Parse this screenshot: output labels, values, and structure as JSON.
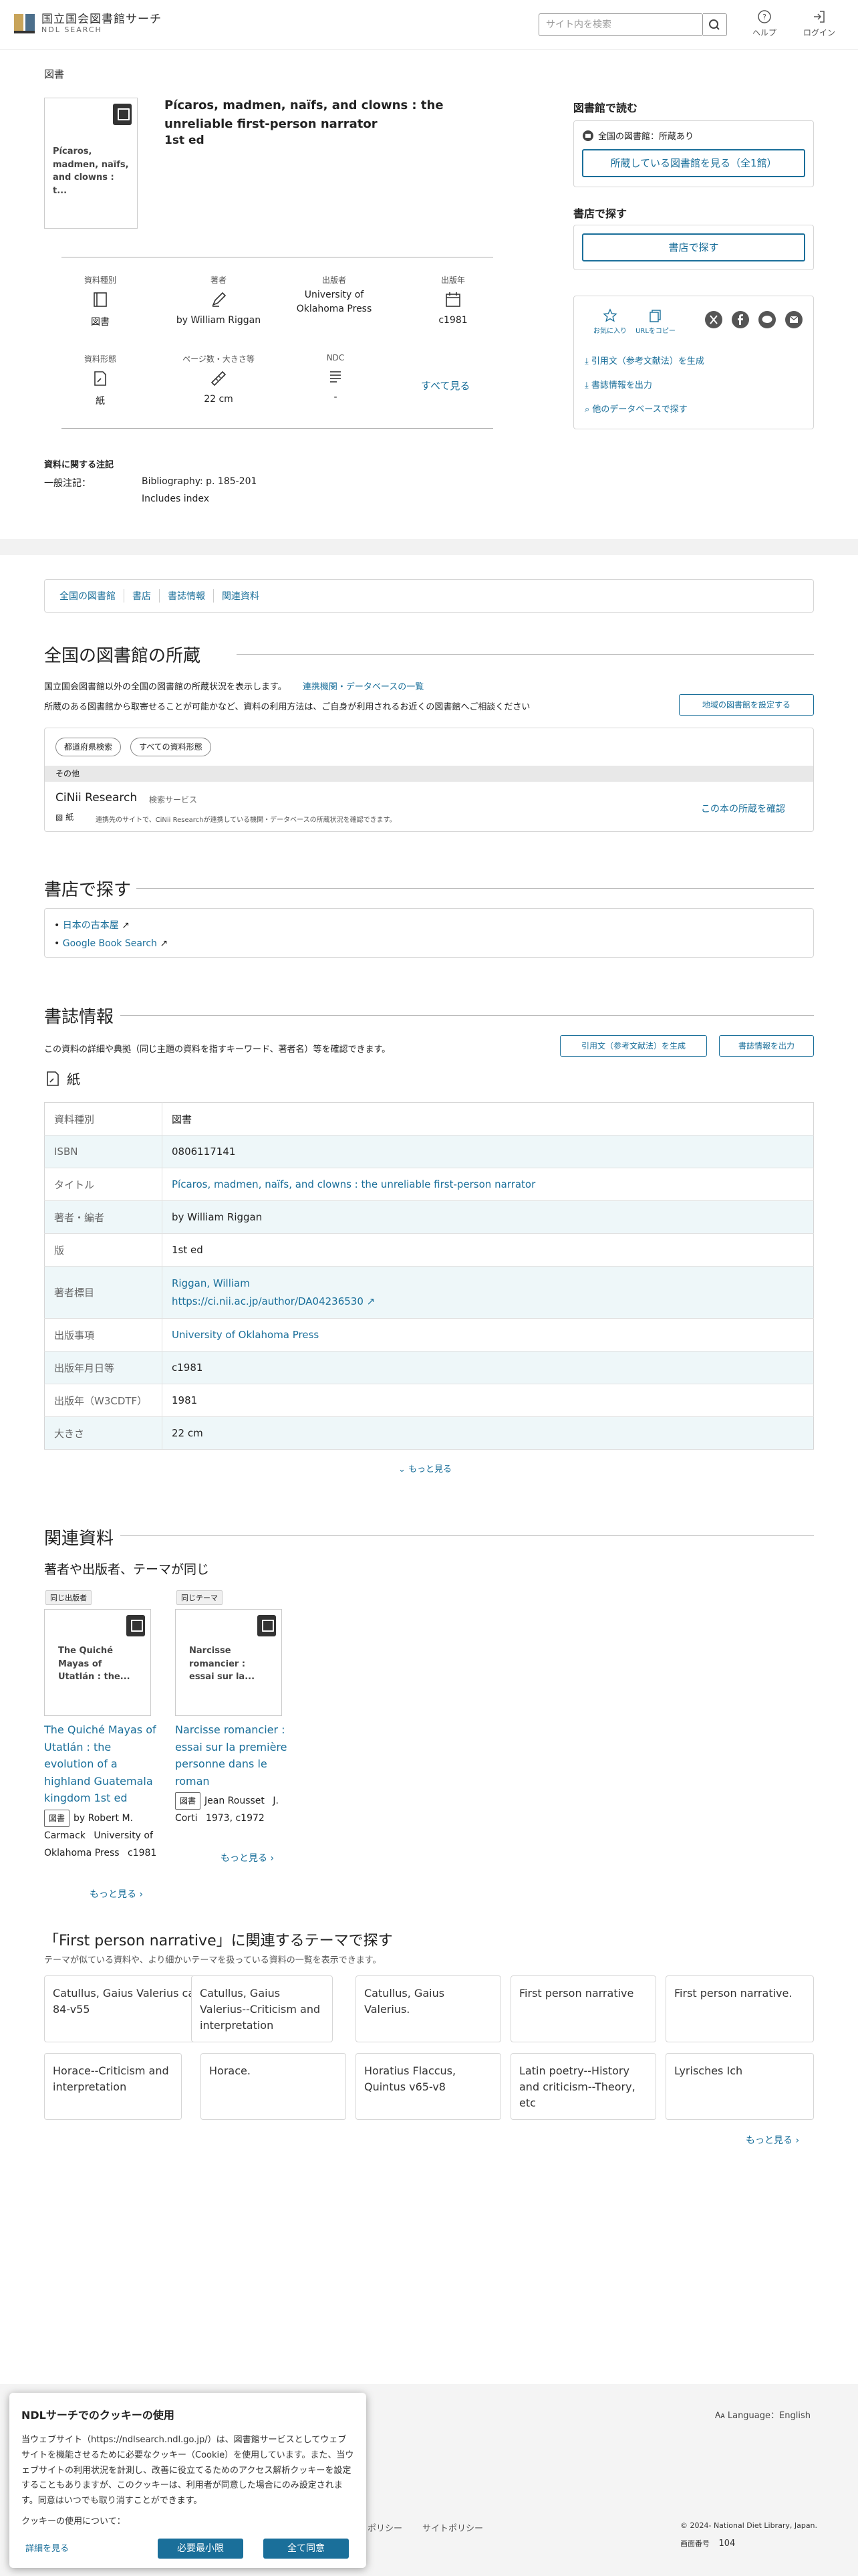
{
  "header": {
    "logo_line1": "国立国会図書館サーチ",
    "logo_line2": "NDL SEARCH",
    "search_placeholder": "サイト内を検索",
    "help_label": "ヘルプ",
    "login_label": "ログイン"
  },
  "item": {
    "category": "図書",
    "title": "Pícaros, madmen, naïfs, and clowns : the unreliable first-person narrator",
    "edition": "1st ed",
    "thumb_text": "Pícaros, madmen, naïfs, and clowns : t...",
    "meta": [
      {
        "label": "資料種別",
        "value": "図書",
        "icon": "book-icon"
      },
      {
        "label": "著者",
        "value": "by William Riggan",
        "icon": "pen-icon"
      },
      {
        "label": "出版者",
        "value": "University of Oklahoma Press",
        "icon": "none"
      },
      {
        "label": "出版年",
        "value": "c1981",
        "icon": "calendar-icon"
      },
      {
        "label": "資料形態",
        "value": "紙",
        "icon": "paper-icon"
      },
      {
        "label": "ページ数・大きさ等",
        "value": "22 cm",
        "icon": "ruler-icon"
      },
      {
        "label": "NDC",
        "value": "-",
        "icon": "list-icon"
      }
    ],
    "see_all": "すべて見る",
    "notes_heading": "資料に関する注記",
    "notes_key": "一般注記：",
    "notes_values": [
      "Bibliography: p. 185-201",
      "Includes index"
    ]
  },
  "sidebar": {
    "library_heading": "図書館で読む",
    "library_status": "全国の図書館：所蔵あり",
    "library_button": "所蔵している図書館を見る（全1館）",
    "store_heading": "書店で探す",
    "store_button": "書店で探す",
    "favorite_label": "お気に入り",
    "copy_url_label": "URLをコピー",
    "cite_link": "引用文（参考文献法）を生成",
    "export_link": "書誌情報を出力",
    "other_db_link": "他のデータベースで探す"
  },
  "tabs": [
    "全国の図書館",
    "書店",
    "書誌情報",
    "関連資料"
  ],
  "holdings": {
    "heading": "全国の図書館の所蔵",
    "desc1": "国立国会図書館以外の全国の図書館の所蔵状況を表示します。",
    "desc1_link": "連携機関・データベースの一覧",
    "desc2": "所蔵のある図書館から取寄せることが可能かなど、資料の利用方法は、ご自身が利用されるお近くの図書館へご相談ください",
    "set_region_button": "地域の図書館を設定する",
    "filter1": "都道府県検索",
    "filter2": "すべての資料形態",
    "group_label": "その他",
    "db_name": "CiNii Research",
    "db_badge": "検索サービス",
    "db_paper": "紙",
    "db_desc": "連携先のサイトで、CiNii Researchが連携している機関・データベースの所蔵状況を確認できます。",
    "db_link": "この本の所蔵を確認"
  },
  "stores": {
    "heading": "書店で探す",
    "links": [
      "日本の古本屋",
      "Google Book Search"
    ]
  },
  "bib": {
    "heading": "書誌情報",
    "desc": "この資料の詳細や典拠（同じ主題の資料を指すキーワード、著者名）等を確認できます。",
    "cite_button": "引用文（参考文献法）を生成",
    "export_button": "書誌情報を出力",
    "format": "紙",
    "rows": [
      {
        "k": "資料種別",
        "v": "図書",
        "link": false
      },
      {
        "k": "ISBN",
        "v": "0806117141",
        "link": false
      },
      {
        "k": "タイトル",
        "v": "Pícaros, madmen, naïfs, and clowns : the unreliable first-person narrator",
        "link": true
      },
      {
        "k": "著者・編者",
        "v": "by William Riggan",
        "link": false
      },
      {
        "k": "版",
        "v": "1st ed",
        "link": false
      },
      {
        "k": "著者標目",
        "v": "Riggan, William",
        "v2": "https://ci.nii.ac.jp/author/DA04236530",
        "link": true
      },
      {
        "k": "出版事項",
        "v": "University of Oklahoma Press",
        "link": true
      },
      {
        "k": "出版年月日等",
        "v": "c1981",
        "link": false
      },
      {
        "k": "出版年（W3CDTF）",
        "v": "1981",
        "link": false
      },
      {
        "k": "大きさ",
        "v": "22 cm",
        "link": false
      }
    ],
    "more": "もっと見る"
  },
  "related": {
    "heading": "関連資料",
    "subheading": "著者や出版者、テーマが同じ",
    "cols": [
      {
        "chip": "同じ出版者",
        "thumb": "The Quiché Mayas of Utatlán : the...",
        "title": "The Quiché Mayas of Utatlán : the evolution of a highland Guatemala kingdom 1st ed",
        "tag": "図書",
        "author": "by Robert M. Carmack",
        "publisher": "University of Oklahoma Press",
        "year": "c1981",
        "more": "もっと見る"
      },
      {
        "chip": "同じテーマ",
        "thumb": "Narcisse romancier : essai sur la...",
        "title": "Narcisse romancier : essai sur la première personne dans le roman",
        "tag": "図書",
        "author": "Jean Rousset",
        "publisher": "J. Corti",
        "year": "1973, c1972",
        "more": "もっと見る"
      }
    ]
  },
  "themes": {
    "heading": "「First person narrative」に関連するテーマで探す",
    "desc": "テーマが似ている資料や、より細かいテーマを扱っている資料の一覧を表示できます。",
    "cards": [
      "Catullus, Gaius Valerius ca. 84-v55",
      "Catullus, Gaius Valerius--Criticism and interpretation",
      "Catullus, Gaius Valerius.",
      "First person narrative",
      "First person narrative.",
      "Horace--Criticism and interpretation",
      "Horace.",
      "Horatius Flaccus, Quintus v65-v8",
      "Latin poetry--History and criticism--Theory, etc",
      "Lyrisches Ich"
    ],
    "more": "もっと見る"
  },
  "footer": {
    "language": "Language：English",
    "links": [
      "ポリシー",
      "サイトポリシー"
    ],
    "copyright": "© 2024- National Diet Library, Japan.",
    "screen_no_label": "画面番号",
    "screen_no": "104"
  },
  "cookie": {
    "title": "NDLサーチでのクッキーの使用",
    "body": "当ウェブサイト（https://ndlsearch.ndl.go.jp/）は、図書館サービスとしてウェブサイトを機能させるために必要なクッキー（Cookie）を使用しています。また、当ウェブサイトの利用状況を計測し、改善に役立てるためのアクセス解析クッキーを設定することもありますが、このクッキーは、利用者が同意した場合にのみ設定されます。同意はいつでも取り消すことができます。",
    "about": "クッキーの使用について：",
    "details": "詳細を見る",
    "minimum": "必要最小限",
    "accept_all": "全て同意"
  },
  "colors": {
    "accent": "#1a6f9a",
    "band": "#f2f2f2"
  }
}
